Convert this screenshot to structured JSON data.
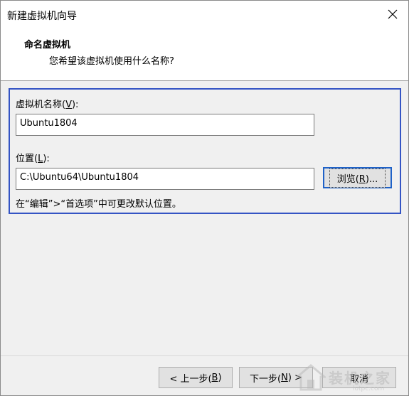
{
  "window": {
    "title": "新建虚拟机向导"
  },
  "header": {
    "title": "命名虚拟机",
    "subtitle": "您希望该虚拟机使用什么名称?"
  },
  "form": {
    "name_label_prefix": "虚拟机名称(",
    "name_label_key": "V",
    "name_label_suffix": "):",
    "name_value": "Ubuntu1804",
    "location_label_prefix": "位置(",
    "location_label_key": "L",
    "location_label_suffix": "):",
    "location_value": "C:\\Ubuntu64\\Ubuntu1804",
    "browse_prefix": "浏览(",
    "browse_key": "R",
    "browse_suffix": ")...",
    "hint": "在“编辑”>“首选项”中可更改默认位置。"
  },
  "footer": {
    "back_prefix": "< 上一步(",
    "back_key": "B",
    "back_suffix": ")",
    "next_prefix": "下一步(",
    "next_key": "N",
    "next_suffix": ") >",
    "cancel_label": "取消"
  },
  "watermark": {
    "text": "装机之家",
    "url": "lotpc.com"
  },
  "icons": {
    "close": "close-icon",
    "watermark_logo": "house-logo-icon"
  },
  "colors": {
    "group_border": "#3454c4",
    "default_button_border": "#1f62c8",
    "background": "#f0f0f0"
  }
}
